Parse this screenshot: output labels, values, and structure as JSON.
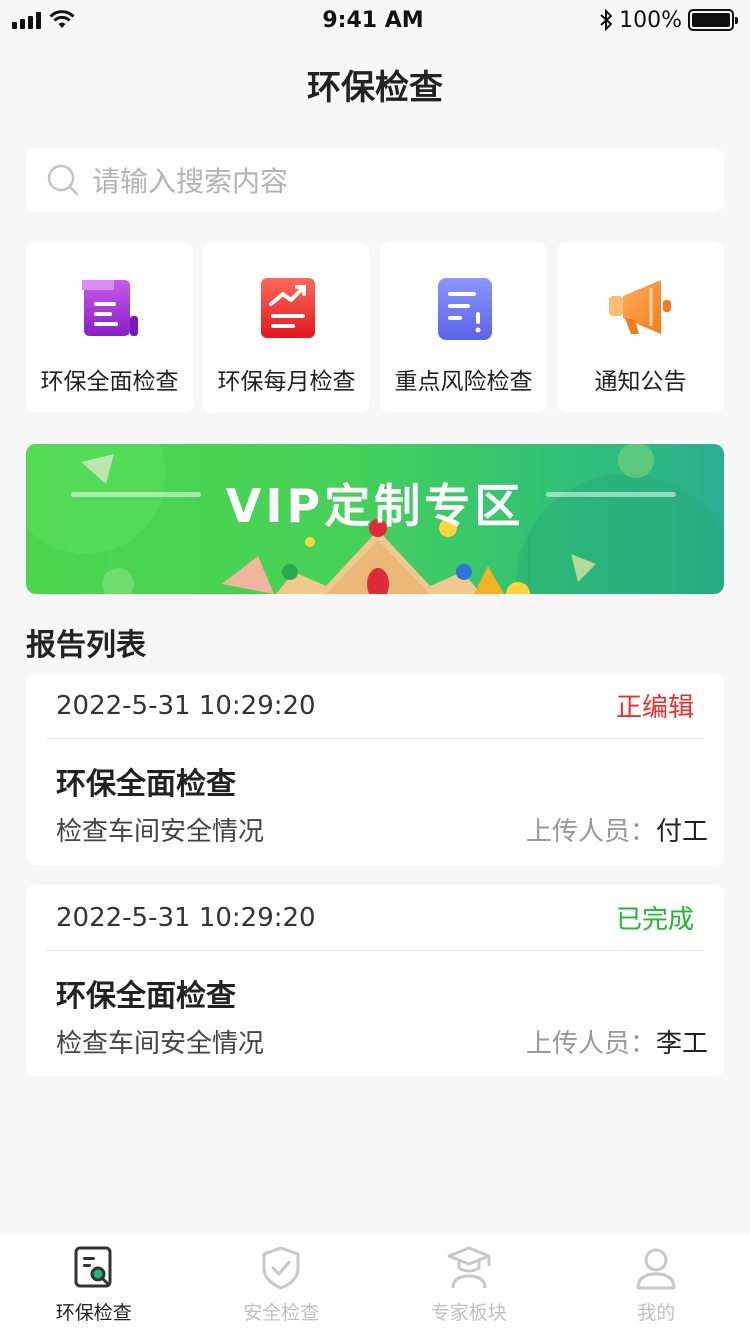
{
  "status_bar": {
    "time": "9:41 AM",
    "battery": "100%"
  },
  "header": {
    "title": "环保检查"
  },
  "search": {
    "placeholder": "请输入搜索内容"
  },
  "quick_grid": [
    {
      "label": "环保全面检查",
      "icon": "document-icon",
      "color": "#a32fd6"
    },
    {
      "label": "环保每月检查",
      "icon": "trend-chart-icon",
      "color": "#f0393b"
    },
    {
      "label": "重点风险检查",
      "icon": "risk-list-icon",
      "color": "#6f7bf2"
    },
    {
      "label": "通知公告",
      "icon": "megaphone-icon",
      "color": "#fb8a2e"
    }
  ],
  "banner": {
    "title": "VIP定制专区"
  },
  "reports": {
    "title": "报告列表",
    "items": [
      {
        "date": "2022-5-31 10:29:20",
        "status": "正编辑",
        "status_color": "#f42e2e",
        "title": "环保全面检查",
        "desc": "检查车间安全情况",
        "uploader_label": "上传人员：",
        "uploader": "付工"
      },
      {
        "date": "2022-5-31 10:29:20",
        "status": "已完成",
        "status_color": "#23b832",
        "title": "环保全面检查",
        "desc": "检查车间安全情况",
        "uploader_label": "上传人员：",
        "uploader": "李工"
      }
    ]
  },
  "tabbar": [
    {
      "label": "环保检查",
      "icon": "env-check-icon",
      "active": true
    },
    {
      "label": "安全检查",
      "icon": "shield-check-icon",
      "active": false
    },
    {
      "label": "专家板块",
      "icon": "expert-icon",
      "active": false
    },
    {
      "label": "我的",
      "icon": "user-icon",
      "active": false
    }
  ]
}
